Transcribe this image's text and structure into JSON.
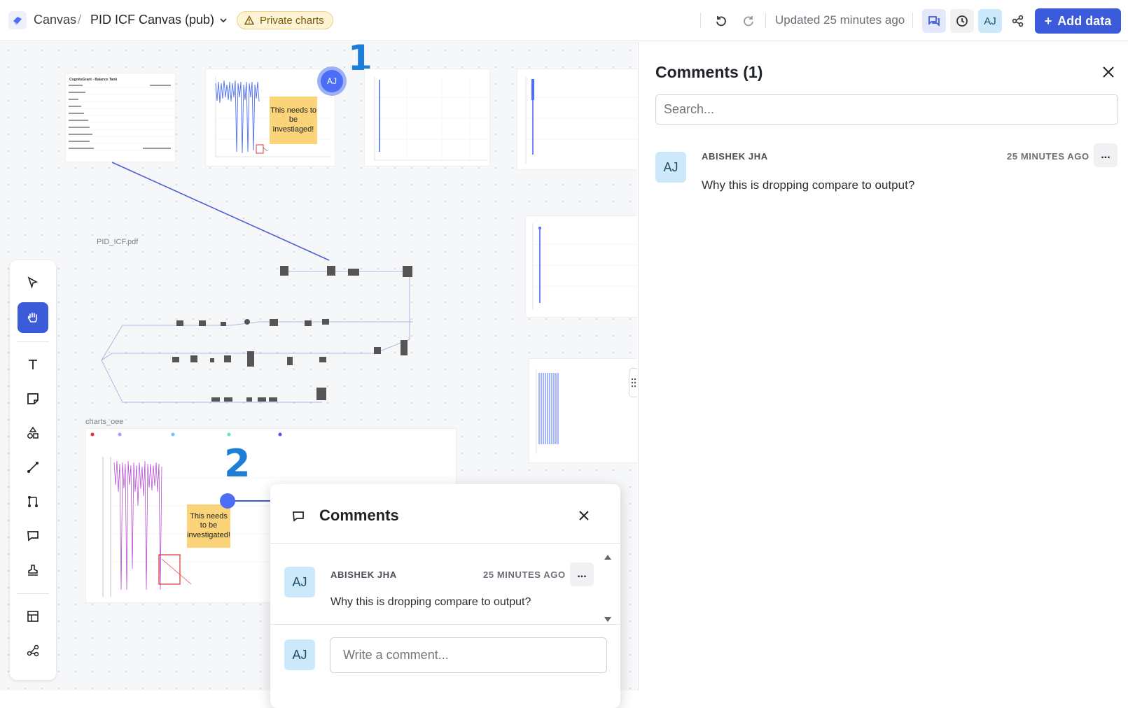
{
  "topbar": {
    "crumb_root": "Canvas",
    "separator": "/",
    "canvas_name": "PID ICF Canvas (pub)",
    "badge_label": "Private charts",
    "updated_text": "Updated 25 minutes ago",
    "user_initials": "AJ",
    "add_button_label": "Add data",
    "add_button_plus": "+"
  },
  "canvas": {
    "pdf_label": "PID_ICF.pdf",
    "charts_label": "charts_oee",
    "annotation_1": "1",
    "annotation_2": "2",
    "sticky_text": "This needs to be investiaged!",
    "sticky_text_2": "This needs to be investigated!",
    "pin_initials": "AJ",
    "balance_tank_title": "CognitaGrant - Balance Tank"
  },
  "toolbar": {
    "tools": [
      "select",
      "hand",
      "text",
      "sticky-note",
      "shapes",
      "line",
      "connector",
      "comment",
      "stamp",
      "table",
      "graph"
    ]
  },
  "comments_panel": {
    "title": "Comments (1)",
    "search_placeholder": "Search...",
    "comment": {
      "initials": "AJ",
      "author": "ABISHEK JHA",
      "time": "25 MINUTES AGO",
      "text": "Why this is dropping compare to output?",
      "more": "..."
    }
  },
  "comment_popup": {
    "title": "Comments",
    "comment": {
      "initials": "AJ",
      "author": "ABISHEK JHA",
      "time": "25 MINUTES AGO",
      "text": "Why this is dropping compare to output?",
      "more": "..."
    },
    "reply_initials": "AJ",
    "reply_placeholder": "Write a comment..."
  },
  "colors": {
    "accent": "#3b5bdb",
    "sticky": "#fbd47a",
    "avatar_bg": "#cbe9fa"
  }
}
